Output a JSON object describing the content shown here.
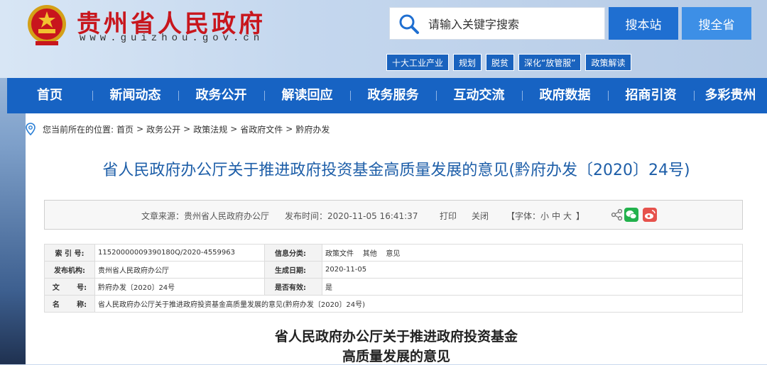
{
  "header": {
    "site_name": "贵州省人民政府",
    "site_url": "www.guizhou.gov.cn",
    "search_placeholder": "请输入关键字搜索",
    "btn_site": "搜本站",
    "btn_province": "搜全省",
    "hot_tags": [
      "十大工业产业",
      "规划",
      "脱贫",
      "深化“放管服”",
      "政策解读"
    ]
  },
  "nav": {
    "items": [
      "首页",
      "新闻动态",
      "政务公开",
      "解读回应",
      "政务服务",
      "互动交流",
      "政府数据",
      "招商引资",
      "多彩贵州"
    ]
  },
  "breadcrumb": {
    "prefix": "您当前所在的位置:",
    "items": [
      "首页",
      "政务公开",
      "政策法规",
      "省政府文件",
      "黔府办发"
    ],
    "separator": ">"
  },
  "article": {
    "title": "省人民政府办公厅关于推进政府投资基金高质量发展的意见(黔府办发〔2020〕24号)",
    "source": "文章来源：贵州省人民政府办公厅",
    "publish_time": "发布时间：2020-11-05 16:41:37",
    "print": "打印",
    "close": "关闭",
    "font_label": "【字体：",
    "font_small": "小",
    "font_medium": "中",
    "font_large": "大",
    "font_end": "】",
    "sub_title_line1": "省人民政府办公厅关于推进政府投资基金",
    "sub_title_line2": "高质量发展的意见"
  },
  "info": {
    "index_label": "索 引 号:",
    "index_value": "11520000009390180Q/2020-4559963",
    "category_label": "信息分类:",
    "category_value": "政策文件    其他    意见",
    "org_label": "发布机构:",
    "org_value": "贵州省人民政府办公厅",
    "date_label": "生成日期:",
    "date_value": "2020-11-05",
    "doc_label": "文       号:",
    "doc_value": "黔府办发〔2020〕24号",
    "valid_label": "是否有效:",
    "valid_value": "是",
    "name_label": "名       称:",
    "name_value": "省人民政府办公厅关于推进政府投资基金高质量发展的意见(黔府办发〔2020〕24号)"
  },
  "colors": {
    "nav_bg": "#1763c3",
    "title_blue": "#1d5ea8",
    "brand_red": "#c8161d",
    "wechat": "#22b14c",
    "weibo": "#e6524c"
  }
}
